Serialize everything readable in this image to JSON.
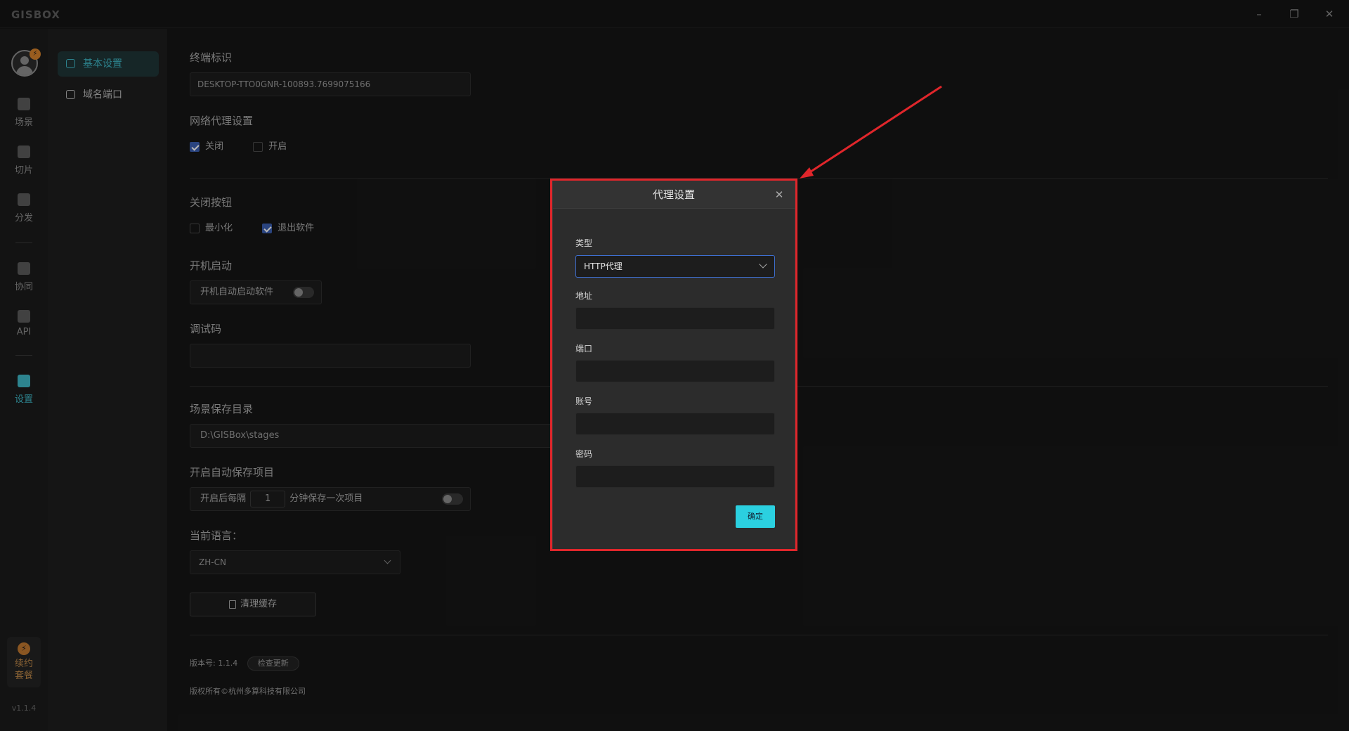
{
  "app": {
    "logo": "GISBOX",
    "window_controls": {
      "minimize": "–",
      "restore": "❐",
      "close": "✕"
    }
  },
  "rail": {
    "items": [
      {
        "label": "场景",
        "icon": "home-icon"
      },
      {
        "label": "切片",
        "icon": "slice-icon"
      },
      {
        "label": "分发",
        "icon": "share-icon"
      },
      {
        "label": "协同",
        "icon": "lock-icon"
      },
      {
        "label": "API",
        "icon": "edit-icon"
      },
      {
        "label": "设置",
        "icon": "gear-icon"
      }
    ],
    "renew_line1": "续约",
    "renew_line2": "套餐",
    "version": "v1.1.4"
  },
  "subnav": {
    "items": [
      "基本设置",
      "域名端口"
    ]
  },
  "settings": {
    "terminal_id_title": "终端标识",
    "terminal_id_value": "DESKTOP-TTO0GNR-100893.7699075166",
    "proxy_title": "网络代理设置",
    "proxy_off": "关闭",
    "proxy_on": "开启",
    "close_btn_title": "关闭按钮",
    "close_minimize": "最小化",
    "close_exit": "退出软件",
    "startup_title": "开机启动",
    "startup_label": "开机自动启动软件",
    "debug_title": "调试码",
    "save_dir_title": "场景保存目录",
    "save_dir_value": "D:\\GISBox\\stages",
    "autosave_title": "开启自动保存项目",
    "autosave_prefix": "开启后每隔",
    "autosave_value": "1",
    "autosave_suffix": "分钟保存一次项目",
    "lang_title": "当前语言：",
    "lang_value": "ZH-CN",
    "clear_cache": "清理缓存",
    "version_label": "版本号: 1.1.4",
    "check_update": "检查更新",
    "copyright": "版权所有©杭州多算科技有限公司"
  },
  "modal": {
    "title": "代理设置",
    "close": "✕",
    "type_label": "类型",
    "type_value": "HTTP代理",
    "address_label": "地址",
    "port_label": "端口",
    "account_label": "账号",
    "password_label": "密码",
    "ok": "确定"
  },
  "colors": {
    "accent": "#3fb8c7",
    "ok_button": "#2bd0e0",
    "annotation": "#e0262b",
    "checkbox": "#3b5fb0"
  }
}
